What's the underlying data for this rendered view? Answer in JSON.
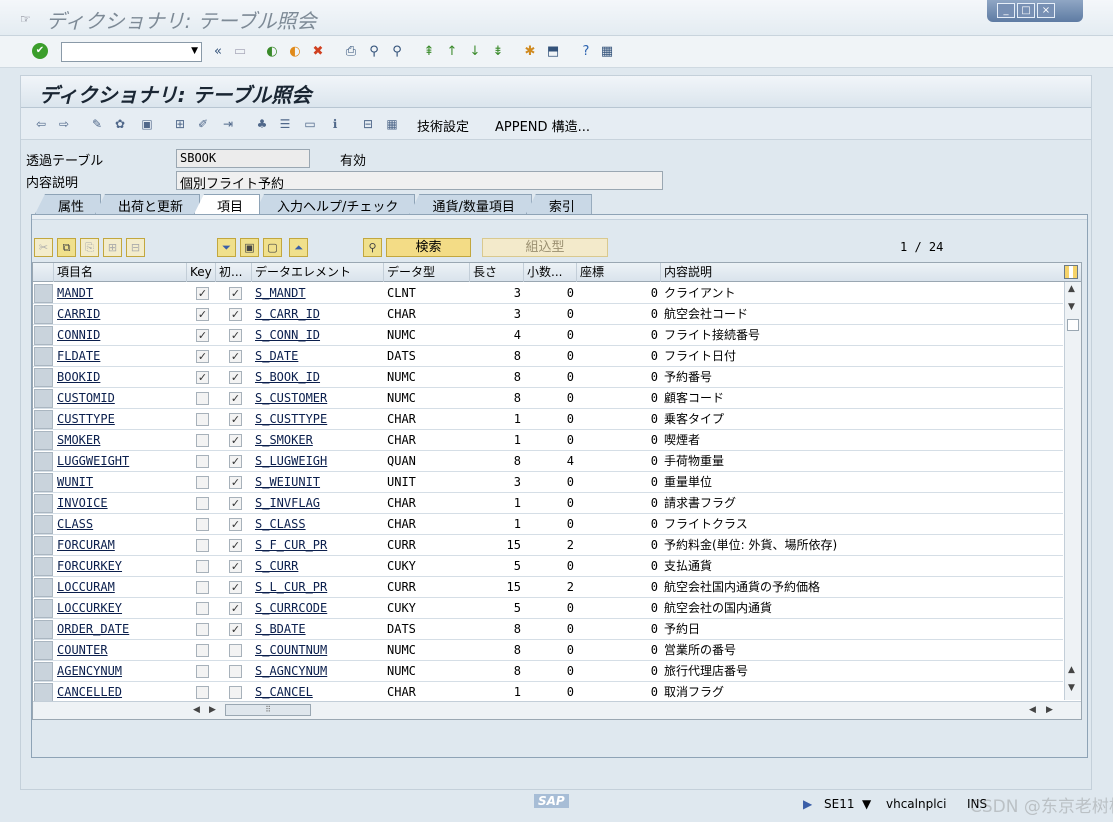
{
  "window": {
    "title": "ディクショナリ: テーブル照会"
  },
  "screen_title": "ディクショナリ: テーブル照会",
  "app_toolbar": {
    "tech_settings": "技術設定",
    "append_structure": "APPEND 構造..."
  },
  "header": {
    "table_label": "透過テーブル",
    "table_value": "SBOOK",
    "status": "有効",
    "desc_label": "内容説明",
    "desc_value": "個別フライト予約"
  },
  "tabs": [
    "属性",
    "出荷と更新",
    "項目",
    "入力ヘルプ/チェック",
    "通貨/数量項目",
    "索引"
  ],
  "active_tab": "項目",
  "table_toolbar": {
    "search": "検索",
    "insert_type": "組込型",
    "page": "1 / 24"
  },
  "columns": [
    "項目名",
    "Key",
    "初...",
    "データエレメント",
    "データ型",
    "長さ",
    "小数...",
    "座標",
    "内容説明"
  ],
  "rows": [
    {
      "name": "MANDT",
      "key": true,
      "init": true,
      "elem": "S_MANDT",
      "type": "CLNT",
      "len": "3",
      "dec": "0",
      "coord": "0",
      "desc": "クライアント"
    },
    {
      "name": "CARRID",
      "key": true,
      "init": true,
      "elem": "S_CARR_ID",
      "type": "CHAR",
      "len": "3",
      "dec": "0",
      "coord": "0",
      "desc": "航空会社コード"
    },
    {
      "name": "CONNID",
      "key": true,
      "init": true,
      "elem": "S_CONN_ID",
      "type": "NUMC",
      "len": "4",
      "dec": "0",
      "coord": "0",
      "desc": "フライト接続番号"
    },
    {
      "name": "FLDATE",
      "key": true,
      "init": true,
      "elem": "S_DATE",
      "type": "DATS",
      "len": "8",
      "dec": "0",
      "coord": "0",
      "desc": "フライト日付"
    },
    {
      "name": "BOOKID",
      "key": true,
      "init": true,
      "elem": "S_BOOK_ID",
      "type": "NUMC",
      "len": "8",
      "dec": "0",
      "coord": "0",
      "desc": "予約番号"
    },
    {
      "name": "CUSTOMID",
      "key": false,
      "init": true,
      "elem": "S_CUSTOMER",
      "type": "NUMC",
      "len": "8",
      "dec": "0",
      "coord": "0",
      "desc": "顧客コード"
    },
    {
      "name": "CUSTTYPE",
      "key": false,
      "init": true,
      "elem": "S_CUSTTYPE",
      "type": "CHAR",
      "len": "1",
      "dec": "0",
      "coord": "0",
      "desc": "乗客タイプ"
    },
    {
      "name": "SMOKER",
      "key": false,
      "init": true,
      "elem": "S_SMOKER",
      "type": "CHAR",
      "len": "1",
      "dec": "0",
      "coord": "0",
      "desc": "喫煙者"
    },
    {
      "name": "LUGGWEIGHT",
      "key": false,
      "init": true,
      "elem": "S_LUGWEIGH",
      "type": "QUAN",
      "len": "8",
      "dec": "4",
      "coord": "0",
      "desc": "手荷物重量"
    },
    {
      "name": "WUNIT",
      "key": false,
      "init": true,
      "elem": "S_WEIUNIT",
      "type": "UNIT",
      "len": "3",
      "dec": "0",
      "coord": "0",
      "desc": "重量単位"
    },
    {
      "name": "INVOICE",
      "key": false,
      "init": true,
      "elem": "S_INVFLAG",
      "type": "CHAR",
      "len": "1",
      "dec": "0",
      "coord": "0",
      "desc": "請求書フラグ"
    },
    {
      "name": "CLASS",
      "key": false,
      "init": true,
      "elem": "S_CLASS",
      "type": "CHAR",
      "len": "1",
      "dec": "0",
      "coord": "0",
      "desc": "フライトクラス"
    },
    {
      "name": "FORCURAM",
      "key": false,
      "init": true,
      "elem": "S_F_CUR_PR",
      "type": "CURR",
      "len": "15",
      "dec": "2",
      "coord": "0",
      "desc": "予約料金(単位: 外貨、場所依存)"
    },
    {
      "name": "FORCURKEY",
      "key": false,
      "init": true,
      "elem": "S_CURR",
      "type": "CUKY",
      "len": "5",
      "dec": "0",
      "coord": "0",
      "desc": "支払通貨"
    },
    {
      "name": "LOCCURAM",
      "key": false,
      "init": true,
      "elem": "S_L_CUR_PR",
      "type": "CURR",
      "len": "15",
      "dec": "2",
      "coord": "0",
      "desc": "航空会社国内通貨の予約価格"
    },
    {
      "name": "LOCCURKEY",
      "key": false,
      "init": true,
      "elem": "S_CURRCODE",
      "type": "CUKY",
      "len": "5",
      "dec": "0",
      "coord": "0",
      "desc": "航空会社の国内通貨"
    },
    {
      "name": "ORDER_DATE",
      "key": false,
      "init": true,
      "elem": "S_BDATE",
      "type": "DATS",
      "len": "8",
      "dec": "0",
      "coord": "0",
      "desc": "予約日"
    },
    {
      "name": "COUNTER",
      "key": false,
      "init": false,
      "elem": "S_COUNTNUM",
      "type": "NUMC",
      "len": "8",
      "dec": "0",
      "coord": "0",
      "desc": "営業所の番号"
    },
    {
      "name": "AGENCYNUM",
      "key": false,
      "init": false,
      "elem": "S_AGNCYNUM",
      "type": "NUMC",
      "len": "8",
      "dec": "0",
      "coord": "0",
      "desc": "旅行代理店番号"
    },
    {
      "name": "CANCELLED",
      "key": false,
      "init": false,
      "elem": "S_CANCEL",
      "type": "CHAR",
      "len": "1",
      "dec": "0",
      "coord": "0",
      "desc": "取消フラグ"
    }
  ],
  "status_bar": {
    "transaction": "SE11",
    "server": "vhcalnplci",
    "mode": "INS"
  },
  "watermark": "CSDN @东京老树根"
}
